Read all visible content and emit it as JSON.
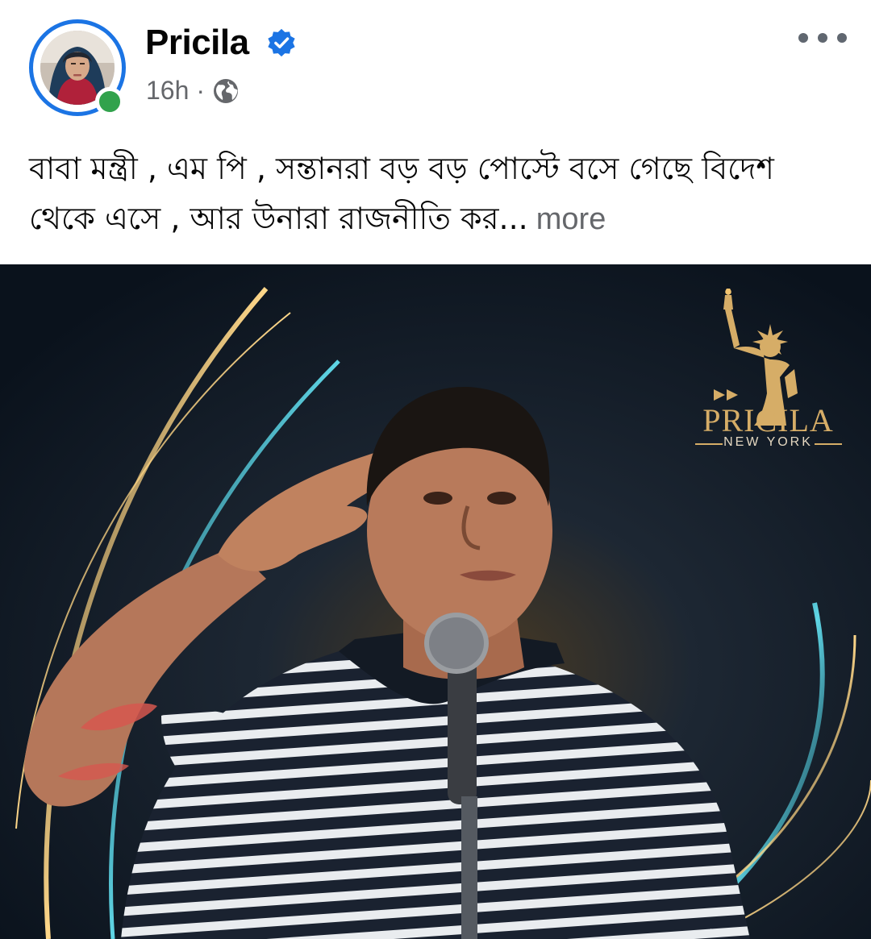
{
  "post": {
    "author": "Pricila",
    "verified": true,
    "online": true,
    "time": "16h",
    "separator": "·",
    "audience_icon": "globe-icon",
    "caption_text": "বাবা মন্ত্রী , এম পি , সন্তানরা বড় বড় পোস্টে বসে গেছে বিদেশ থেকে এসে , আর উনারা রাজনীতি কর...",
    "more_label": "more"
  },
  "image": {
    "brand_name": "PRICILA",
    "brand_sub": "NEW YORK"
  },
  "colors": {
    "accent": "#1b74e4",
    "online": "#31a24c",
    "muted": "#65676b",
    "brand_gold": "#d6ad67"
  }
}
